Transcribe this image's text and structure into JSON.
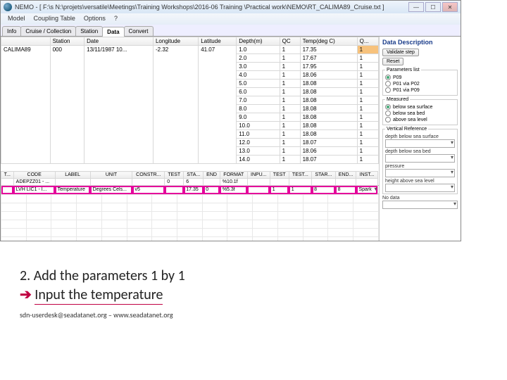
{
  "window": {
    "title": "NEMO - [ F:\\s N:\\projets\\versatile\\Meetings\\Training Workshops\\2016-06 Training \\Practical work\\NEMO\\RT_CALIMA89_Cruise.txt ]"
  },
  "menu": {
    "items": [
      "Model",
      "Coupling Table",
      "Options",
      "?"
    ]
  },
  "tabs": {
    "items": [
      "Info",
      "Cruise / Collection",
      "Station",
      "Data",
      "Convert"
    ],
    "activeIndex": 3
  },
  "upperHeaders": [
    "",
    "Station",
    "Date",
    "Longitude",
    "Latitude",
    "Depth(m)",
    "QC",
    "Temp(deg C)",
    "Q..."
  ],
  "upperFirst": [
    "CALIMA89",
    "000",
    "13/11/1987 10...",
    "-2.32",
    "41.07"
  ],
  "upperRows": [
    [
      "1.0",
      "1",
      "17.35",
      "1"
    ],
    [
      "2.0",
      "1",
      "17.67",
      "1"
    ],
    [
      "3.0",
      "1",
      "17.95",
      "1"
    ],
    [
      "4.0",
      "1",
      "18.06",
      "1"
    ],
    [
      "5.0",
      "1",
      "18.08",
      "1"
    ],
    [
      "6.0",
      "1",
      "18.08",
      "1"
    ],
    [
      "7.0",
      "1",
      "18.08",
      "1"
    ],
    [
      "8.0",
      "1",
      "18.08",
      "1"
    ],
    [
      "9.0",
      "1",
      "18.08",
      "1"
    ],
    [
      "10.0",
      "1",
      "18.08",
      "1"
    ],
    [
      "11.0",
      "1",
      "18.08",
      "1"
    ],
    [
      "12.0",
      "1",
      "18.07",
      "1"
    ],
    [
      "13.0",
      "1",
      "18.06",
      "1"
    ],
    [
      "14.0",
      "1",
      "18.07",
      "1"
    ]
  ],
  "lowerHeaders": [
    "T...",
    "CODE",
    "LABEL",
    "UNIT",
    "CONSTR...",
    "TEST",
    "STA...",
    "END",
    "FORMAT",
    "INPU...",
    "TEST",
    "TEST...",
    "STAR...",
    "END...",
    "INST..."
  ],
  "lowerRows": [
    {
      "cells": [
        "",
        "ADEPZZ01 - ...",
        "",
        "",
        "",
        "0",
        "6",
        "",
        "%10.1f",
        "",
        "",
        "",
        "",
        "",
        ""
      ],
      "sel": false
    },
    {
      "cells": [
        "",
        "LVH LIC1 - I...",
        "Temperature",
        "Degrees Cels...",
        "v5",
        "",
        "17.35",
        "0",
        "%5.3f",
        "",
        "1",
        "1",
        "8",
        "8",
        "Spark"
      ],
      "sel": true
    }
  ],
  "right": {
    "heading": "Data Description",
    "btnValidate": "Validate step",
    "btnReset": "Reset",
    "legendParams": "Parameters list",
    "radios": [
      "P09",
      "P01 via P02",
      "P01 via P09"
    ],
    "legendMeasured": "Measured",
    "measured": [
      "below sea surface",
      "below sea bed",
      "above sea level"
    ],
    "legendVR": "Vertical Reference",
    "vrLabel1": "depth below sea surface",
    "vrLabel2": "depth below sea bed",
    "vrLabel3": "pressure",
    "vrLabel4": "height above sea level",
    "noData": "No data"
  },
  "slide": {
    "line1": "2. Add the parameters 1 by 1",
    "line2a": "Input the temperature",
    "footer": "sdn-userdesk@seadatanet.org – www.seadatanet.org"
  }
}
